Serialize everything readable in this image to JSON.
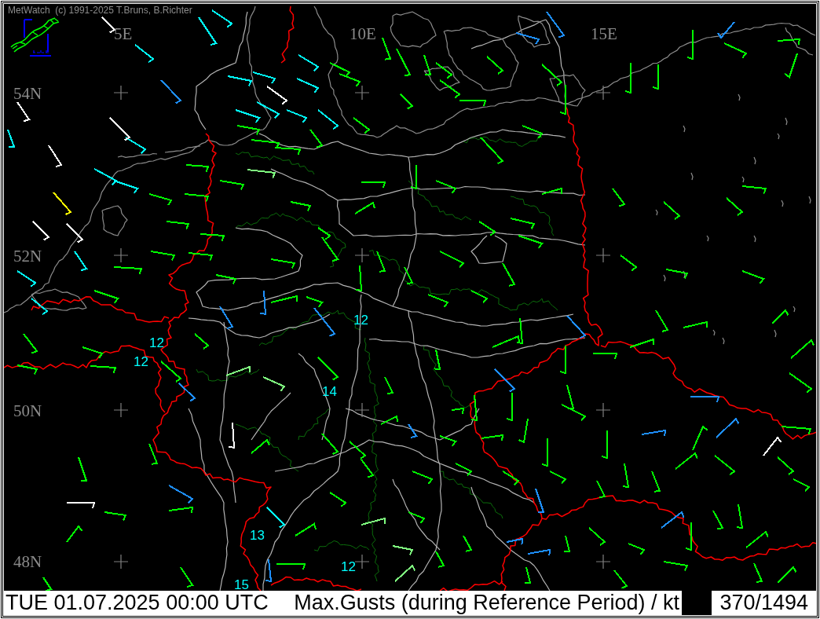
{
  "header": {
    "copyright": "MetWatch  (c) 1991-2025 T.Bruns, B.Richter"
  },
  "map": {
    "longitude_labels": [
      "5E",
      "10E",
      "15E"
    ],
    "latitude_labels": [
      "54N",
      "52N",
      "50N",
      "48N"
    ],
    "gust_values": [
      "12",
      "12",
      "12",
      "14",
      "13",
      "12",
      "15"
    ],
    "wind_barbs": [
      {
        "color": "#00ff00"
      },
      {
        "color": "#80ff80"
      },
      {
        "color": "#00ffff"
      },
      {
        "color": "#1e90ff"
      },
      {
        "color": "#ffffff"
      },
      {
        "color": "#ffff00"
      }
    ]
  },
  "status_bar": {
    "datetime": "TUE 01.07.2025 00:00 UTC",
    "title": "Max.Gusts (during Reference Period) / kt",
    "station_count": "370/1494"
  }
}
